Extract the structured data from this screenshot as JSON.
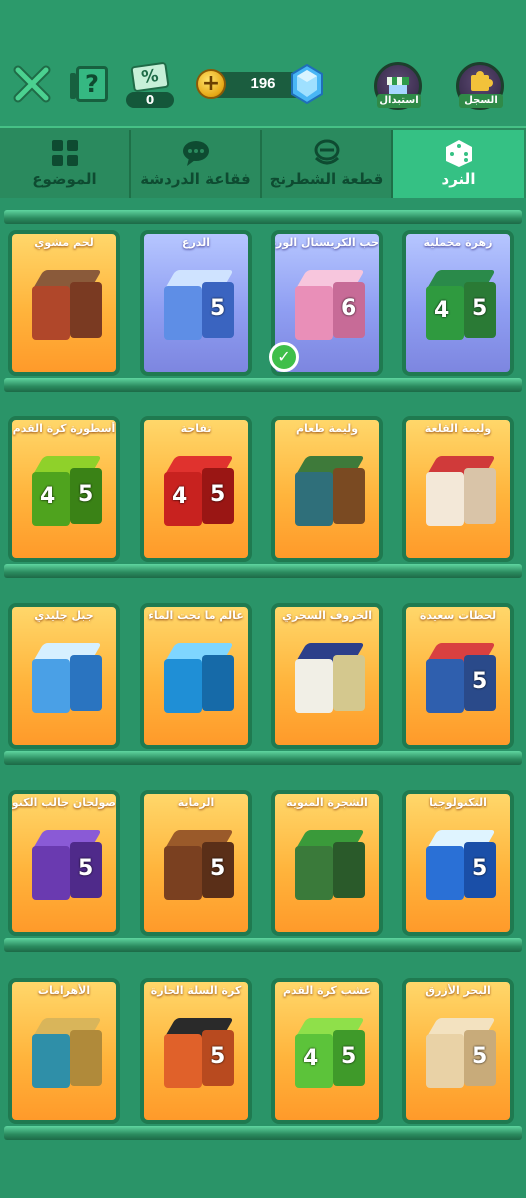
{
  "topbar": {
    "help_label": "?",
    "coupon_symbol": "%",
    "coupon_count": "0",
    "coins_plus": "+",
    "coins_amount": "196",
    "exchange_label": "استبدال",
    "log_label": "السجل"
  },
  "tabs": [
    {
      "label": "الموضوع",
      "icon": "grid-icon",
      "active": false
    },
    {
      "label": "فقاعة الدردشة",
      "icon": "chat-bubble-icon",
      "active": false
    },
    {
      "label": "قطعة الشطرنج",
      "icon": "chess-piece-icon",
      "active": false
    },
    {
      "label": "النرد",
      "icon": "dice-icon",
      "active": true
    }
  ],
  "cards": [
    {
      "name": "زهرة مخملية",
      "style": "blue",
      "top": "#2a8a4a",
      "front": "#2f9a3f",
      "side": "#2a7a35",
      "n1": "4",
      "n2": "5"
    },
    {
      "name": "حب الكريستال الوردي",
      "style": "blue",
      "top": "#f7c6dd",
      "front": "#e98fb8",
      "side": "#c76b97",
      "n1": "",
      "n2": "6",
      "selected": true
    },
    {
      "name": "الدرع",
      "style": "blue",
      "top": "#cfe3ff",
      "front": "#5e8ee6",
      "side": "#3a64c0",
      "n1": "",
      "n2": "5"
    },
    {
      "name": "لحم مشوي",
      "style": "orange",
      "top": "#8a5a3a",
      "front": "#b0472a",
      "side": "#7a3a22",
      "n1": "",
      "n2": ""
    },
    {
      "name": "وليمة القلعة",
      "style": "orange",
      "top": "#d03a3a",
      "front": "#f3e8d8",
      "side": "#d9c4a8",
      "n1": "",
      "n2": ""
    },
    {
      "name": "وليمة طعام",
      "style": "orange",
      "top": "#3e7a3a",
      "front": "#2f6f7a",
      "side": "#7a4a22",
      "n1": "",
      "n2": ""
    },
    {
      "name": "تفاحة",
      "style": "orange",
      "top": "#e0322e",
      "front": "#c8221f",
      "side": "#9a1614",
      "n1": "4",
      "n2": "5"
    },
    {
      "name": "أسطورة كرة القدم",
      "style": "orange",
      "top": "#8fd12a",
      "front": "#4fa31e",
      "side": "#3a8216",
      "n1": "4",
      "n2": "5"
    },
    {
      "name": "لحظات سعيدة",
      "style": "orange",
      "top": "#d94040",
      "front": "#2f5fae",
      "side": "#2a4a8a",
      "n1": "",
      "n2": "5"
    },
    {
      "name": "الخروف السحري",
      "style": "orange",
      "top": "#2c3f8a",
      "front": "#f1efe6",
      "side": "#d4c88e",
      "n1": "",
      "n2": ""
    },
    {
      "name": "عالم ما تحت الماء",
      "style": "orange",
      "top": "#7fd6ff",
      "front": "#1f8fd6",
      "side": "#166aa8",
      "n1": "",
      "n2": ""
    },
    {
      "name": "جبل جليدي",
      "style": "orange",
      "top": "#d6f0ff",
      "front": "#4aa0e6",
      "side": "#2a74c0",
      "n1": "",
      "n2": ""
    },
    {
      "name": "التكنولوجيا",
      "style": "orange",
      "top": "#dff4ff",
      "front": "#2a70d6",
      "side": "#1a4fa8",
      "n1": "",
      "n2": "5"
    },
    {
      "name": "الشجرة المنوية",
      "style": "orange",
      "top": "#3a9a3a",
      "front": "#3a7a3a",
      "side": "#2a5a2a",
      "n1": "",
      "n2": ""
    },
    {
      "name": "الرماية",
      "style": "orange",
      "top": "#9a5a2a",
      "front": "#7a4020",
      "side": "#5a2f18",
      "n1": "",
      "n2": "5"
    },
    {
      "name": "صولجان جالب الكنوز",
      "style": "orange",
      "top": "#8a5ad6",
      "front": "#6a3ab0",
      "side": "#4f2a8a",
      "n1": "",
      "n2": "5"
    },
    {
      "name": "البحر الأزرق",
      "style": "orange",
      "top": "#f3e2c0",
      "front": "#e9d2a6",
      "side": "#c8ab7a",
      "n1": "",
      "n2": "5"
    },
    {
      "name": "عشب كرة القدم",
      "style": "orange",
      "top": "#8fe04a",
      "front": "#5cc33a",
      "side": "#3f9a2a",
      "n1": "4",
      "n2": "5"
    },
    {
      "name": "كرة السلة الحارة",
      "style": "orange",
      "top": "#2a2a2a",
      "front": "#e0612a",
      "side": "#b84a1f",
      "n1": "",
      "n2": "5"
    },
    {
      "name": "الأهرامات",
      "style": "orange",
      "top": "#d9b55a",
      "front": "#2f8fa8",
      "side": "#b08a3a",
      "n1": "",
      "n2": ""
    }
  ]
}
